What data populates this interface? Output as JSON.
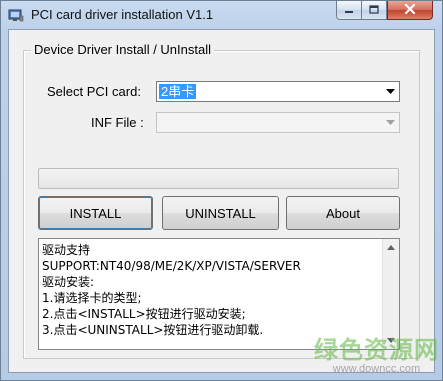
{
  "window": {
    "title": "PCI card driver installation V1.1"
  },
  "group": {
    "title": "Device Driver Install / UnInstall"
  },
  "select_pci": {
    "label": "Select PCI card:",
    "value": "2串卡"
  },
  "inf_file": {
    "label": "INF File :",
    "value": ""
  },
  "progress": {
    "value": 0
  },
  "buttons": {
    "install": "INSTALL",
    "uninstall": "UNINSTALL",
    "about": "About"
  },
  "info_lines": [
    "驱动支持",
    "SUPPORT:NT40/98/ME/2K/XP/VISTA/SERVER",
    "驱动安装:",
    "1.请选择卡的类型;",
    "2.点击<INSTALL>按钮进行驱动安装;",
    "3.点击<UNINSTALL>按钮进行驱动卸载."
  ],
  "watermark": {
    "text": "绿色资源网",
    "url": "www.downcc.com"
  },
  "colors": {
    "selection": "#3399ff",
    "title_bar": "#bcd1ea",
    "dialog_bg": "#f0f0f0",
    "close_button": "#c0432c"
  },
  "icons": {
    "app": "pc-card-icon",
    "minimize": "minimize-icon",
    "maximize": "maximize-icon",
    "close": "close-icon",
    "dropdown": "chevron-down-icon",
    "scroll_up": "scroll-up-arrow-icon",
    "scroll_down": "scroll-down-arrow-icon"
  }
}
